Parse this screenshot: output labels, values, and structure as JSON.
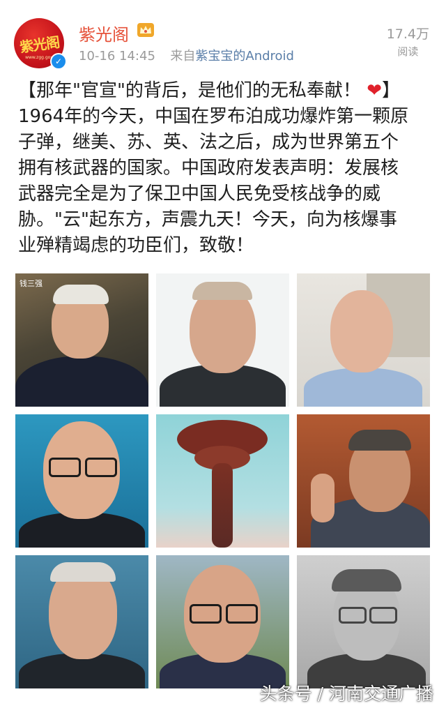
{
  "post": {
    "username": "紫光阁",
    "timestamp": "10-16 14:45",
    "source_prefix": "来自",
    "source_client": "紫宝宝的Android",
    "views_count": "17.4万",
    "views_label": "阅读",
    "avatar_logo_text": "紫光阁",
    "avatar_logo_sub": "www.zgg.gov",
    "line1": "【那年\"官宣\"的背后，是他们的无私奉献！",
    "line1_heart": "❤",
    "line1_end": "】",
    "line2": "1964年的今天，中国在罗布泊成功爆炸第一颗原",
    "line3": "子弹，继美、苏、英、法之后，成为世界第五个",
    "line4": "拥有核武器的国家。中国政府发表声明：发展核",
    "line5": "武器完全是为了保卫中国人民免受核战争的威",
    "line6": "胁。\"云\"起东方，声震九天！今天，向为核爆事",
    "line7": "业殚精竭虑的功臣们，致敬！"
  },
  "photos": {
    "first_caption": "钱三强",
    "count": 9
  },
  "watermark": "头条号 / 河南交通广播",
  "colors": {
    "username": "#e6523a",
    "verified_badge": "#1a8dec",
    "meta_gray": "#9a9a9a",
    "heart": "#e0212b"
  },
  "icons": [
    "verified-badge-icon",
    "crown-icon",
    "heart-icon"
  ]
}
